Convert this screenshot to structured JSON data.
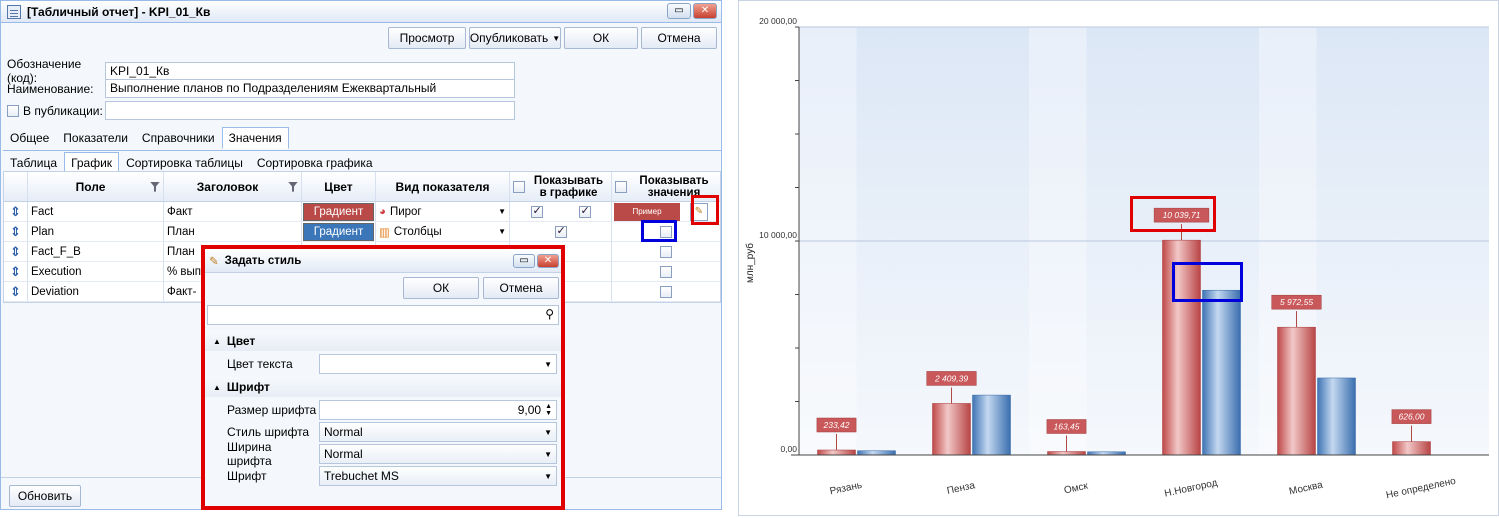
{
  "window": {
    "title": "[Табличный отчет] - KPI_01_Кв"
  },
  "toolbar": {
    "preview": "Просмотр",
    "publish": "Опубликовать",
    "ok": "ОК",
    "cancel": "Отмена"
  },
  "form": {
    "code_label": "Обозначение (код):",
    "code_value": "KPI_01_Кв",
    "name_label": "Наименование:",
    "name_value": "Выполнение планов по Подразделениям Ежеквартальный",
    "publish_label": "В публикации:"
  },
  "main_tabs": [
    "Общее",
    "Показатели",
    "Справочники",
    "Значения"
  ],
  "sub_tabs": [
    "Таблица",
    "График",
    "Сортировка таблицы",
    "Сортировка графика"
  ],
  "grid": {
    "headers": {
      "field": "Поле",
      "caption": "Заголовок",
      "color": "Цвет",
      "view": "Вид показателя",
      "show_chart": "Показывать в графике",
      "show_values": "Показывать значения"
    },
    "rows": [
      {
        "field": "Fact",
        "caption": "Факт",
        "color_label": "Градиент",
        "color": "#b94a48",
        "view": "Пирог",
        "show_chart": true,
        "sample": "Пример"
      },
      {
        "field": "Plan",
        "caption": "План",
        "color_label": "Градиент",
        "color": "#3a76b8",
        "view": "Столбцы",
        "show_chart": true
      },
      {
        "field": "Fact_F_B",
        "caption": "План"
      },
      {
        "field": "Execution",
        "caption": "% вып"
      },
      {
        "field": "Deviation",
        "caption": "Факт-"
      }
    ]
  },
  "bottom": {
    "refresh": "Обновить"
  },
  "dialog": {
    "title": "Задать стиль",
    "ok": "ОК",
    "cancel": "Отмена",
    "section_color": "Цвет",
    "text_color_label": "Цвет текста",
    "section_font": "Шрифт",
    "font_size_label": "Размер шрифта",
    "font_size_value": "9,00",
    "font_style_label": "Стиль шрифта",
    "font_style_value": "Normal",
    "font_weight_label": "Ширина шрифта",
    "font_weight_value": "Normal",
    "font_label": "Шрифт",
    "font_value": "Trebuchet MS"
  },
  "chart_data": {
    "type": "bar",
    "ylabel": "млн_руб",
    "ylim": [
      0,
      20000
    ],
    "yticks": [
      "0,00",
      "10 000,00",
      "20 000,00"
    ],
    "categories": [
      "Рязань",
      "Пенза",
      "Омск",
      "Н.Новгород",
      "Москва",
      "Не определено"
    ],
    "series": [
      {
        "values": [
          233.42,
          2409.39,
          163.45,
          10039.71,
          5972.55,
          626.0
        ],
        "labels": [
          "233,42",
          "2 409,39",
          "163,45",
          "10 039,71",
          "5 972,55",
          "626,00"
        ],
        "color": "#c9585a"
      },
      {
        "values": [
          200,
          2800,
          150,
          7700,
          3600,
          0
        ],
        "color": "#4f86c6"
      }
    ]
  }
}
